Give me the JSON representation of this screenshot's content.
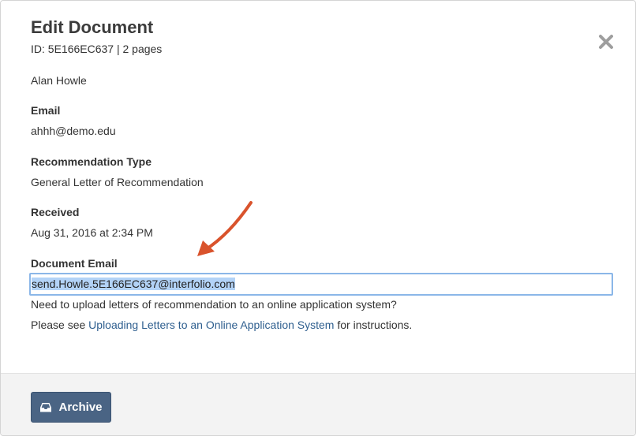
{
  "modal": {
    "title": "Edit Document",
    "doc_meta": "ID: 5E166EC637 | 2 pages"
  },
  "fields": {
    "name": "Alan Howle",
    "email_label": "Email",
    "email_value": "ahhh@demo.edu",
    "rec_type_label": "Recommendation Type",
    "rec_type_value": "General Letter of Recommendation",
    "received_label": "Received",
    "received_value": "Aug 31, 2016 at 2:34 PM",
    "doc_email_label": "Document Email",
    "doc_email_value": "send.Howle.5E166EC637@interfolio.com"
  },
  "help": {
    "question": "Need to upload letters of recommendation to an online application system?",
    "please_see": "Please see ",
    "link_text": "Uploading Letters to an Online Application System",
    "suffix": " for instructions."
  },
  "footer": {
    "archive_label": "Archive"
  },
  "icons": {
    "close": "close-icon",
    "archive": "inbox-icon",
    "annotation": "red-arrow-annotation"
  },
  "colors": {
    "archive_button": "#4a6484",
    "link": "#2f5f8f",
    "input_focus": "#8bb7e8",
    "selection": "#b3d3f7",
    "annotation_arrow": "#d9532c"
  }
}
